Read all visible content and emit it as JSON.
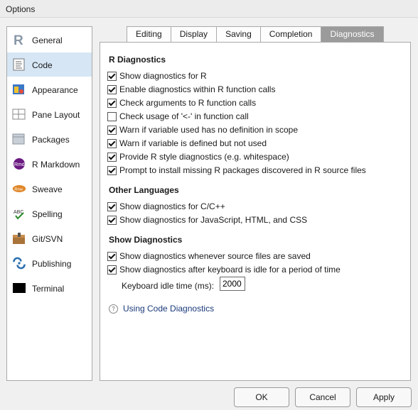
{
  "window": {
    "title": "Options"
  },
  "sidebar": {
    "items": [
      {
        "label": "General",
        "icon": "r-logo-icon"
      },
      {
        "label": "Code",
        "icon": "code-page-icon"
      },
      {
        "label": "Appearance",
        "icon": "appearance-icon"
      },
      {
        "label": "Pane Layout",
        "icon": "pane-layout-icon"
      },
      {
        "label": "Packages",
        "icon": "packages-icon"
      },
      {
        "label": "R Markdown",
        "icon": "rmd-icon"
      },
      {
        "label": "Sweave",
        "icon": "sweave-icon"
      },
      {
        "label": "Spelling",
        "icon": "spelling-icon"
      },
      {
        "label": "Git/SVN",
        "icon": "git-svn-icon"
      },
      {
        "label": "Publishing",
        "icon": "publishing-icon"
      },
      {
        "label": "Terminal",
        "icon": "terminal-icon"
      }
    ],
    "selected": "Code"
  },
  "tabs": [
    {
      "label": "Editing"
    },
    {
      "label": "Display"
    },
    {
      "label": "Saving"
    },
    {
      "label": "Completion"
    },
    {
      "label": "Diagnostics"
    }
  ],
  "active_tab": "Diagnostics",
  "sections": {
    "r": {
      "title": "R Diagnostics",
      "options": [
        {
          "label": "Show diagnostics for R",
          "checked": true
        },
        {
          "label": "Enable diagnostics within R function calls",
          "checked": true
        },
        {
          "label": "Check arguments to R function calls",
          "checked": true
        },
        {
          "label": "Check usage of '<-' in function call",
          "checked": false
        },
        {
          "label": "Warn if variable used has no definition in scope",
          "checked": true
        },
        {
          "label": "Warn if variable is defined but not used",
          "checked": true
        },
        {
          "label": "Provide R style diagnostics (e.g. whitespace)",
          "checked": true
        },
        {
          "label": "Prompt to install missing R packages discovered in R source files",
          "checked": true
        }
      ]
    },
    "other": {
      "title": "Other Languages",
      "options": [
        {
          "label": "Show diagnostics for C/C++",
          "checked": true
        },
        {
          "label": "Show diagnostics for JavaScript, HTML, and CSS",
          "checked": true
        }
      ]
    },
    "show": {
      "title": "Show Diagnostics",
      "options": [
        {
          "label": "Show diagnostics whenever source files are saved",
          "checked": true
        },
        {
          "label": "Show diagnostics after keyboard is idle for a period of time",
          "checked": true
        }
      ]
    }
  },
  "idle": {
    "label": "Keyboard idle time (ms):",
    "value": "2000"
  },
  "help_link": "Using Code Diagnostics",
  "buttons": {
    "ok": "OK",
    "cancel": "Cancel",
    "apply": "Apply"
  },
  "colors": {
    "selected_bg": "#d6e6f5",
    "active_tab": "#9b9b9b",
    "link": "#1a3a7a"
  }
}
